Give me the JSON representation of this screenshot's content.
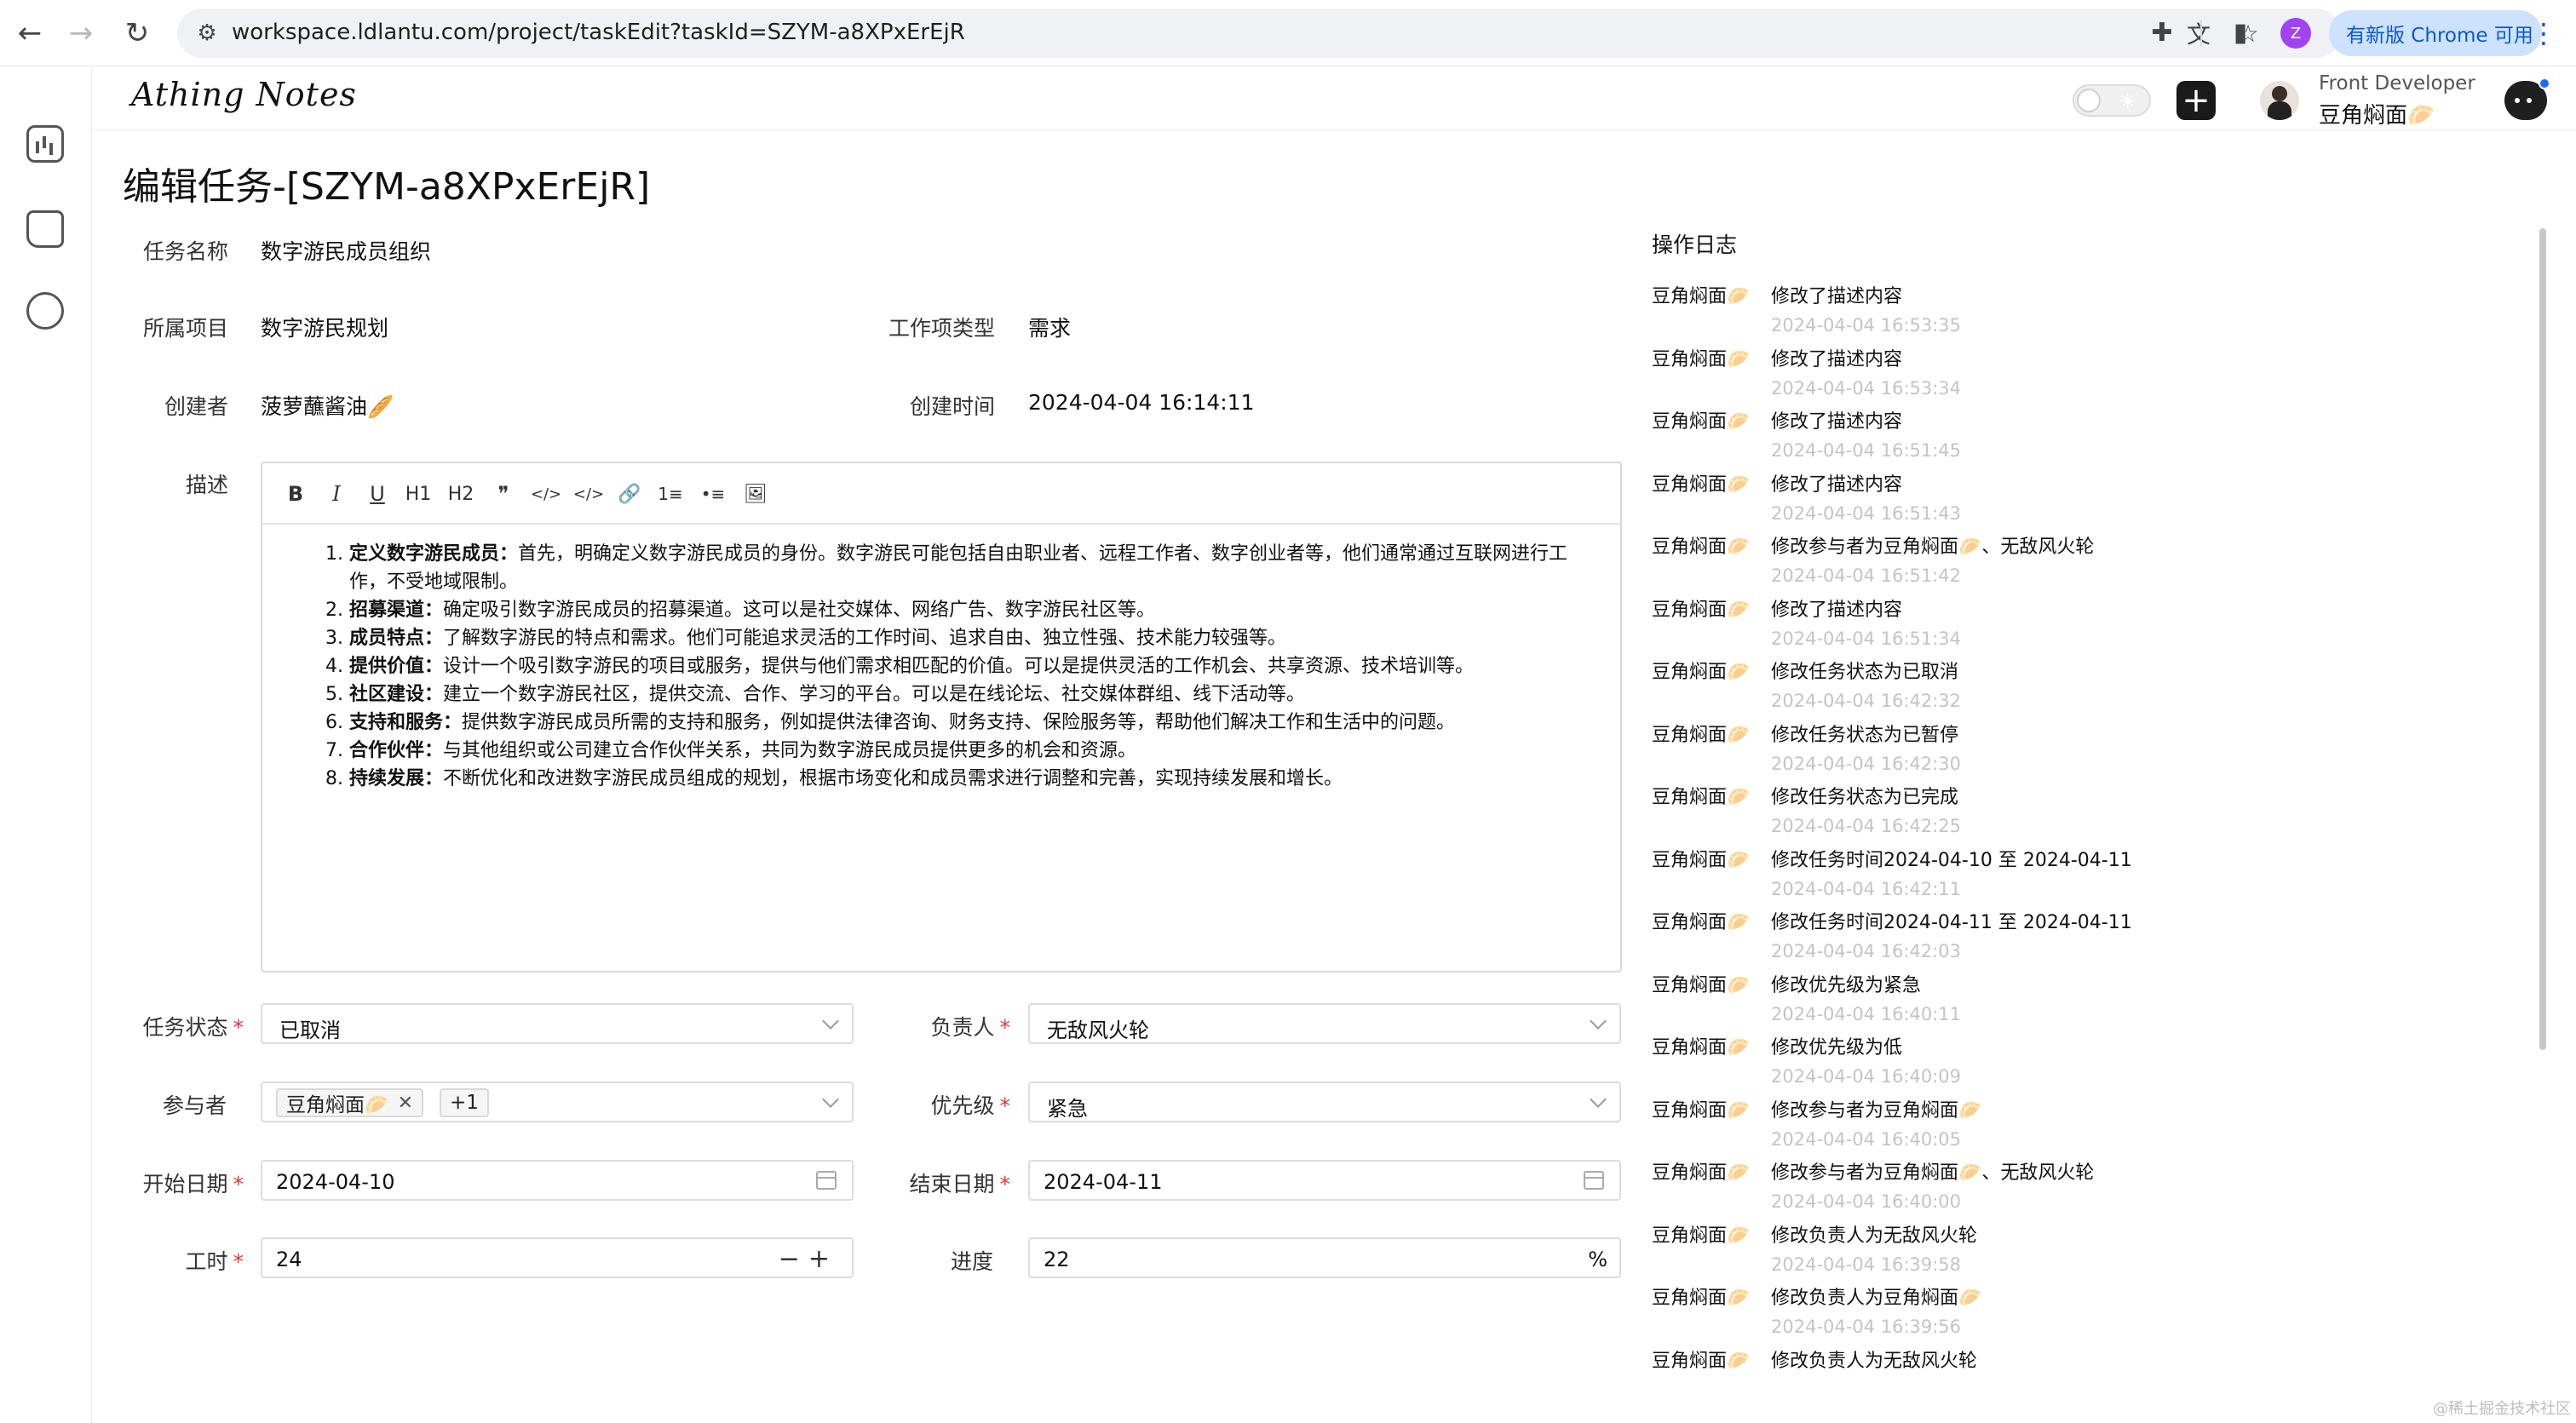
{
  "browser": {
    "url": "workspace.ldlantu.com/project/taskEdit?taskId=SZYM-a8XPxErEjR",
    "profile_initial": "Z",
    "update_label": "有新版 Chrome 可用"
  },
  "app": {
    "logo": "Athing Notes",
    "user_role": "Front Developer",
    "user_name": "豆角焖面🥟"
  },
  "page": {
    "title": "编辑任务-[SZYM-a8XPxErEjR]"
  },
  "form": {
    "task_name_label": "任务名称",
    "task_name": "数字游民成员组织",
    "project_label": "所属项目",
    "project": "数字游民规划",
    "work_type_label": "工作项类型",
    "work_type": "需求",
    "creator_label": "创建者",
    "creator": "菠萝蘸酱油🥖",
    "created_time_label": "创建时间",
    "created_time": "2024-04-04 16:14:11",
    "desc_label": "描述",
    "status_label": "任务状态",
    "status": "已取消",
    "assignee_label": "负责人",
    "assignee": "无敌风火轮",
    "participants_label": "参与者",
    "participant_tag": "豆角焖面🥟",
    "participant_more": "+1",
    "priority_label": "优先级",
    "priority": "紧急",
    "start_label": "开始日期",
    "start_date": "2024-04-10",
    "end_label": "结束日期",
    "end_date": "2024-04-11",
    "hours_label": "工时",
    "hours": "24",
    "progress_label": "进度",
    "progress": "22",
    "progress_suffix": "%",
    "required_mark": "*"
  },
  "editor": {
    "toolbar": [
      "B",
      "I",
      "U",
      "H1",
      "H2",
      "❞",
      "</>",
      "</>",
      "🔗",
      "1≡",
      "•≡",
      "🖼"
    ],
    "items": [
      {
        "title": "定义数字游民成员：",
        "text": "首先，明确定义数字游民成员的身份。数字游民可能包括自由职业者、远程工作者、数字创业者等，他们通常通过互联网进行工作，不受地域限制。"
      },
      {
        "title": "招募渠道：",
        "text": "确定吸引数字游民成员的招募渠道。这可以是社交媒体、网络广告、数字游民社区等。"
      },
      {
        "title": "成员特点：",
        "text": "了解数字游民的特点和需求。他们可能追求灵活的工作时间、追求自由、独立性强、技术能力较强等。"
      },
      {
        "title": "提供价值：",
        "text": "设计一个吸引数字游民的项目或服务，提供与他们需求相匹配的价值。可以是提供灵活的工作机会、共享资源、技术培训等。"
      },
      {
        "title": "社区建设：",
        "text": "建立一个数字游民社区，提供交流、合作、学习的平台。可以是在线论坛、社交媒体群组、线下活动等。"
      },
      {
        "title": "支持和服务：",
        "text": "提供数字游民成员所需的支持和服务，例如提供法律咨询、财务支持、保险服务等，帮助他们解决工作和生活中的问题。"
      },
      {
        "title": "合作伙伴：",
        "text": "与其他组织或公司建立合作伙伴关系，共同为数字游民成员提供更多的机会和资源。"
      },
      {
        "title": "持续发展：",
        "text": "不断优化和改进数字游民成员组成的规划，根据市场变化和成员需求进行调整和完善，实现持续发展和增长。"
      }
    ]
  },
  "log": {
    "title": "操作日志",
    "entries": [
      {
        "user": "豆角焖面🥟",
        "action": "修改了描述内容",
        "time": "2024-04-04 16:53:35"
      },
      {
        "user": "豆角焖面🥟",
        "action": "修改了描述内容",
        "time": "2024-04-04 16:53:34"
      },
      {
        "user": "豆角焖面🥟",
        "action": "修改了描述内容",
        "time": "2024-04-04 16:51:45"
      },
      {
        "user": "豆角焖面🥟",
        "action": "修改了描述内容",
        "time": "2024-04-04 16:51:43"
      },
      {
        "user": "豆角焖面🥟",
        "action": "修改参与者为豆角焖面🥟、无敌风火轮",
        "time": "2024-04-04 16:51:42"
      },
      {
        "user": "豆角焖面🥟",
        "action": "修改了描述内容",
        "time": "2024-04-04 16:51:34"
      },
      {
        "user": "豆角焖面🥟",
        "action": "修改任务状态为已取消",
        "time": "2024-04-04 16:42:32"
      },
      {
        "user": "豆角焖面🥟",
        "action": "修改任务状态为已暂停",
        "time": "2024-04-04 16:42:30"
      },
      {
        "user": "豆角焖面🥟",
        "action": "修改任务状态为已完成",
        "time": "2024-04-04 16:42:25"
      },
      {
        "user": "豆角焖面🥟",
        "action": "修改任务时间2024-04-10 至 2024-04-11",
        "time": "2024-04-04 16:42:11"
      },
      {
        "user": "豆角焖面🥟",
        "action": "修改任务时间2024-04-11 至 2024-04-11",
        "time": "2024-04-04 16:42:03"
      },
      {
        "user": "豆角焖面🥟",
        "action": "修改优先级为紧急",
        "time": "2024-04-04 16:40:11"
      },
      {
        "user": "豆角焖面🥟",
        "action": "修改优先级为低",
        "time": "2024-04-04 16:40:09"
      },
      {
        "user": "豆角焖面🥟",
        "action": "修改参与者为豆角焖面🥟",
        "time": "2024-04-04 16:40:05"
      },
      {
        "user": "豆角焖面🥟",
        "action": "修改参与者为豆角焖面🥟、无敌风火轮",
        "time": "2024-04-04 16:40:00"
      },
      {
        "user": "豆角焖面🥟",
        "action": "修改负责人为无敌风火轮",
        "time": "2024-04-04 16:39:58"
      },
      {
        "user": "豆角焖面🥟",
        "action": "修改负责人为豆角焖面🥟",
        "time": "2024-04-04 16:39:56"
      },
      {
        "user": "豆角焖面🥟",
        "action": "修改负责人为无敌风火轮",
        "time": ""
      }
    ]
  },
  "watermark": "@稀土掘金技术社区"
}
